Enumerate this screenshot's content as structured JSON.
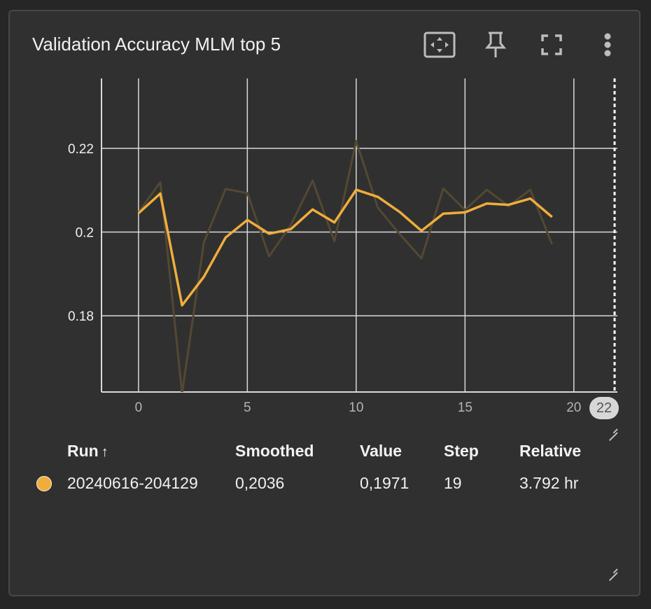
{
  "card": {
    "title": "Validation Accuracy MLM top 5",
    "toolbar": [
      {
        "name": "fit-domain-icon"
      },
      {
        "name": "pin-icon"
      },
      {
        "name": "fullscreen-icon"
      },
      {
        "name": "more-vert-icon"
      }
    ],
    "step_badge": "22"
  },
  "chart_data": {
    "type": "line",
    "title": "Validation Accuracy MLM top 5",
    "xlabel": "",
    "ylabel": "",
    "xlim": [
      -1.7,
      22
    ],
    "ylim": [
      0.1618,
      0.2367
    ],
    "x_ticks": [
      0,
      5,
      10,
      15,
      20
    ],
    "x_tick_labels": [
      "0",
      "5",
      "10",
      "15",
      "20"
    ],
    "y_ticks": [
      0.18,
      0.2,
      0.22
    ],
    "y_tick_labels": [
      "0.18",
      "0.2",
      "0.22"
    ],
    "grid": true,
    "step_marker": 22,
    "series": [
      {
        "role": "raw",
        "color": "#534833",
        "x": [
          0,
          1,
          2,
          3,
          4,
          5,
          6,
          7,
          8,
          9,
          10,
          11,
          12,
          13,
          14,
          15,
          16,
          17,
          18,
          19
        ],
        "values": [
          0.2047,
          0.2119,
          0.1614,
          0.1975,
          0.2103,
          0.2093,
          0.1942,
          0.2017,
          0.2123,
          0.1978,
          0.2217,
          0.2058,
          0.1995,
          0.1937,
          0.2104,
          0.2053,
          0.2101,
          0.2062,
          0.2101,
          0.1971
        ]
      },
      {
        "role": "smoothed",
        "color": "#f0ad3c",
        "x": [
          0,
          1,
          2,
          3,
          4,
          5,
          6,
          7,
          8,
          9,
          10,
          11,
          12,
          13,
          14,
          15,
          16,
          17,
          18,
          19
        ],
        "values": [
          0.2045,
          0.2092,
          0.1825,
          0.1893,
          0.1987,
          0.2029,
          0.1996,
          0.2007,
          0.2054,
          0.2023,
          0.2101,
          0.2084,
          0.2048,
          0.2003,
          0.2044,
          0.2047,
          0.2068,
          0.2065,
          0.208,
          0.2036
        ]
      }
    ]
  },
  "table": {
    "headers": {
      "run": "Run",
      "run_sort": "↑",
      "smoothed": "Smoothed",
      "value": "Value",
      "step": "Step",
      "relative": "Relative"
    },
    "rows": [
      {
        "color": "#f0ad3c",
        "run": "20240616-204129",
        "smoothed": "0,2036",
        "value": "0,1971",
        "step": "19",
        "relative": "3.792 hr"
      }
    ]
  }
}
